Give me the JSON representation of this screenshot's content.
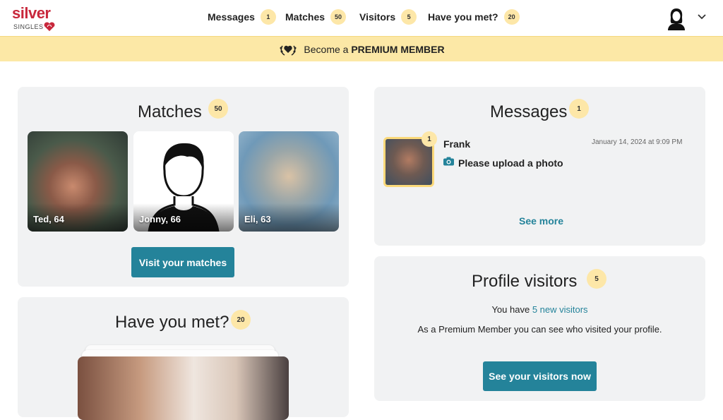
{
  "brand": {
    "name_top": "silver",
    "name_bottom": "SINGLES"
  },
  "nav": [
    {
      "label": "Messages",
      "count": "1"
    },
    {
      "label": "Matches",
      "count": "50"
    },
    {
      "label": "Visitors",
      "count": "5"
    },
    {
      "label": "Have you met?",
      "count": "20"
    }
  ],
  "banner": {
    "prefix": "Become a",
    "emph": "PREMIUM MEMBER"
  },
  "matches": {
    "title": "Matches",
    "count": "50",
    "people": [
      {
        "name": "Ted, 64"
      },
      {
        "name": "Jonny, 66"
      },
      {
        "name": "Eli, 63"
      }
    ],
    "button": "Visit your matches"
  },
  "messages": {
    "title": "Messages",
    "count": "1",
    "item": {
      "sender": "Frank",
      "unread": "1",
      "date": "January 14, 2024 at 9:09 PM",
      "text": "Please upload a photo"
    },
    "see_more": "See more"
  },
  "have_you_met": {
    "title": "Have you met?",
    "count": "20"
  },
  "visitors": {
    "title": "Profile visitors",
    "count": "5",
    "line1_prefix": "You have",
    "line1_link": "5 new visitors",
    "line2": "As a Premium Member you can see who visited your profile.",
    "button": "See your visitors now"
  },
  "colors": {
    "accent": "#24839a",
    "brand": "#c8283c",
    "badge": "#fde7a8",
    "banner": "#fce8a6",
    "card": "#f1f2f3"
  }
}
